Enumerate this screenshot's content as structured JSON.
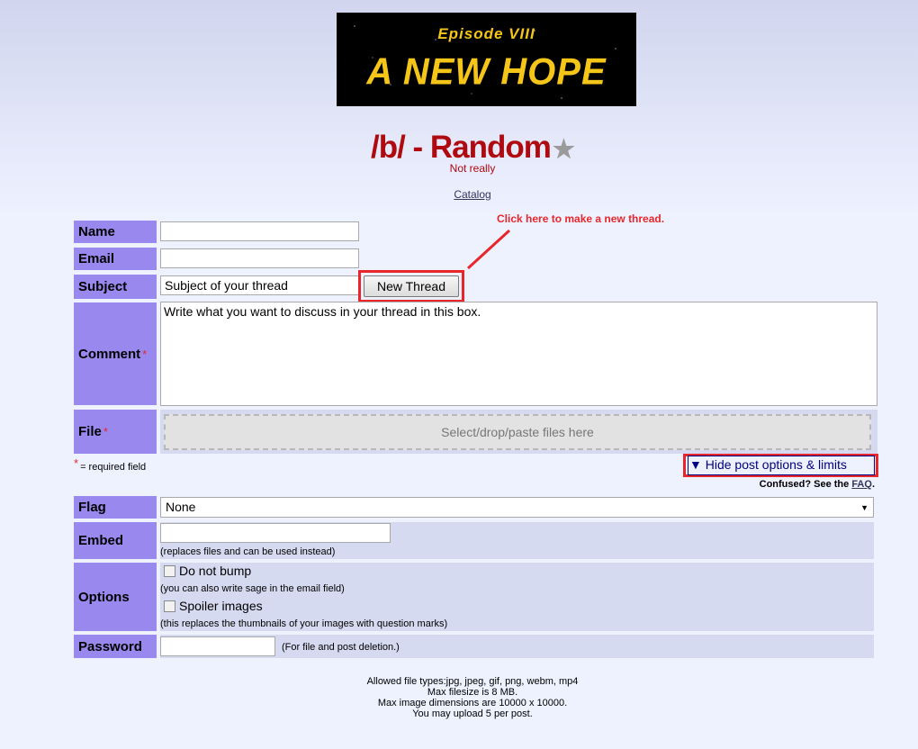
{
  "banner": {
    "line1": "Episode VIII",
    "line2": "A NEW HOPE"
  },
  "board": {
    "title": "/b/ - Random",
    "star": "★",
    "subtitle": "Not really",
    "catalog_link": "Catalog"
  },
  "annotation": "Click here to make a new thread.",
  "form": {
    "name_label": "Name",
    "email_label": "Email",
    "subject_label": "Subject",
    "subject_value": "Subject of your thread",
    "new_thread_button": "New Thread",
    "comment_label": "Comment",
    "comment_value": "Write what you want to discuss in your thread in this box.",
    "file_label": "File",
    "required_marker": "*",
    "dropzone_text": "Select/drop/paste files here",
    "required_note": "= required field",
    "hide_options_link": "▼ Hide post options & limits",
    "confused_text": "Confused? See the ",
    "faq_link": "FAQ",
    "faq_suffix": ".",
    "flag_label": "Flag",
    "flag_value": "None",
    "embed_label": "Embed",
    "embed_note": "(replaces files and can be used instead)",
    "options_label": "Options",
    "do_not_bump": "Do not bump",
    "sage_note": "(you can also write sage in the email field)",
    "spoiler_images": "Spoiler images",
    "spoiler_note": "(this replaces the thumbnails of your images with question marks)",
    "password_label": "Password",
    "password_note": "(For file and post deletion.)"
  },
  "footer": {
    "line1": "Allowed file types:jpg, jpeg, gif, png, webm, mp4",
    "line2": "Max filesize is 8 MB.",
    "line3": "Max image dimensions are 10000 x 10000.",
    "line4": "You may upload 5 per post."
  },
  "colors": {
    "label_bg": "#9988ee",
    "title": "#af0a0f",
    "highlight": "#e8262b"
  }
}
